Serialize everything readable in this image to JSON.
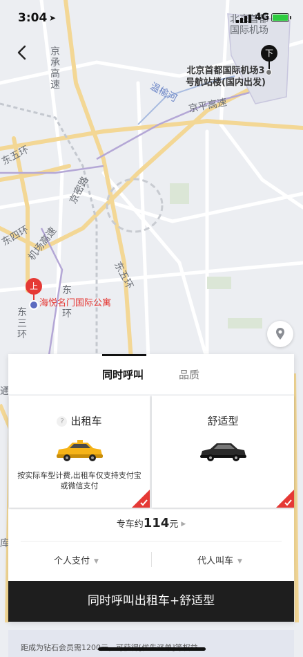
{
  "status_bar": {
    "time": "3:04",
    "network": "4G"
  },
  "map": {
    "labels": {
      "airport_top": "北京首都\n国际机场",
      "jingcheng": "京承高速",
      "wenyu_river": "温榆河",
      "jingping": "京平高速",
      "dong_wuhuan_left": "东五环",
      "jingmi": "京密路",
      "jichang": "机场高速",
      "dong_sihuan": "东四环",
      "dong_wuhuan": "东五环",
      "dong_sanhuan": "东三环",
      "dong_col": "东",
      "huan_col": "环",
      "tong": "通",
      "ku": "库"
    },
    "destination": {
      "marker": "下",
      "label": "北京首都国际机场3号航站楼(国内出发)"
    },
    "start": {
      "marker": "上",
      "label": "海悦名门国际公寓"
    }
  },
  "panel": {
    "tabs": [
      {
        "label": "同时呼叫",
        "active": true
      },
      {
        "label": "品质",
        "active": false
      }
    ],
    "cards": {
      "taxi": {
        "title": "出租车",
        "help": "?",
        "desc": "按实际车型计费,出租车仅支持支付宝或微信支付",
        "selected": true,
        "car_color": "#f5b318"
      },
      "comfort": {
        "title": "舒适型",
        "selected": true,
        "car_color": "#2a2a2a"
      }
    },
    "price": {
      "prefix": "专车约",
      "amount": "114",
      "unit": "元"
    },
    "options": {
      "payment": "个人支付",
      "call_for": "代人叫车"
    },
    "cta": "同时呼叫出租车+舒适型"
  },
  "member_bar": "距成为钻石会员需1200元，可获得[优先派单]等权益",
  "colors": {
    "accent_red": "#e53935",
    "cta_bg": "#1e1e1e",
    "road": "#f6d796",
    "river": "#9ab0d8"
  }
}
